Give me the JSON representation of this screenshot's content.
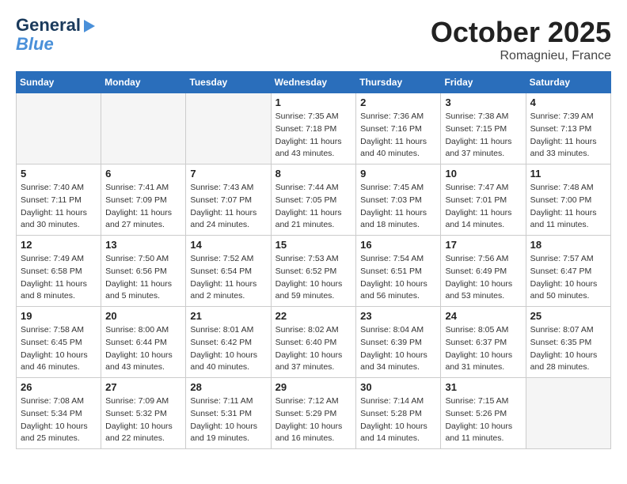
{
  "header": {
    "logo_line1": "General",
    "logo_line2": "Blue",
    "month": "October 2025",
    "location": "Romagnieu, France"
  },
  "weekdays": [
    "Sunday",
    "Monday",
    "Tuesday",
    "Wednesday",
    "Thursday",
    "Friday",
    "Saturday"
  ],
  "weeks": [
    [
      {
        "day": "",
        "info": ""
      },
      {
        "day": "",
        "info": ""
      },
      {
        "day": "",
        "info": ""
      },
      {
        "day": "1",
        "info": "Sunrise: 7:35 AM\nSunset: 7:18 PM\nDaylight: 11 hours\nand 43 minutes."
      },
      {
        "day": "2",
        "info": "Sunrise: 7:36 AM\nSunset: 7:16 PM\nDaylight: 11 hours\nand 40 minutes."
      },
      {
        "day": "3",
        "info": "Sunrise: 7:38 AM\nSunset: 7:15 PM\nDaylight: 11 hours\nand 37 minutes."
      },
      {
        "day": "4",
        "info": "Sunrise: 7:39 AM\nSunset: 7:13 PM\nDaylight: 11 hours\nand 33 minutes."
      }
    ],
    [
      {
        "day": "5",
        "info": "Sunrise: 7:40 AM\nSunset: 7:11 PM\nDaylight: 11 hours\nand 30 minutes."
      },
      {
        "day": "6",
        "info": "Sunrise: 7:41 AM\nSunset: 7:09 PM\nDaylight: 11 hours\nand 27 minutes."
      },
      {
        "day": "7",
        "info": "Sunrise: 7:43 AM\nSunset: 7:07 PM\nDaylight: 11 hours\nand 24 minutes."
      },
      {
        "day": "8",
        "info": "Sunrise: 7:44 AM\nSunset: 7:05 PM\nDaylight: 11 hours\nand 21 minutes."
      },
      {
        "day": "9",
        "info": "Sunrise: 7:45 AM\nSunset: 7:03 PM\nDaylight: 11 hours\nand 18 minutes."
      },
      {
        "day": "10",
        "info": "Sunrise: 7:47 AM\nSunset: 7:01 PM\nDaylight: 11 hours\nand 14 minutes."
      },
      {
        "day": "11",
        "info": "Sunrise: 7:48 AM\nSunset: 7:00 PM\nDaylight: 11 hours\nand 11 minutes."
      }
    ],
    [
      {
        "day": "12",
        "info": "Sunrise: 7:49 AM\nSunset: 6:58 PM\nDaylight: 11 hours\nand 8 minutes."
      },
      {
        "day": "13",
        "info": "Sunrise: 7:50 AM\nSunset: 6:56 PM\nDaylight: 11 hours\nand 5 minutes."
      },
      {
        "day": "14",
        "info": "Sunrise: 7:52 AM\nSunset: 6:54 PM\nDaylight: 11 hours\nand 2 minutes."
      },
      {
        "day": "15",
        "info": "Sunrise: 7:53 AM\nSunset: 6:52 PM\nDaylight: 10 hours\nand 59 minutes."
      },
      {
        "day": "16",
        "info": "Sunrise: 7:54 AM\nSunset: 6:51 PM\nDaylight: 10 hours\nand 56 minutes."
      },
      {
        "day": "17",
        "info": "Sunrise: 7:56 AM\nSunset: 6:49 PM\nDaylight: 10 hours\nand 53 minutes."
      },
      {
        "day": "18",
        "info": "Sunrise: 7:57 AM\nSunset: 6:47 PM\nDaylight: 10 hours\nand 50 minutes."
      }
    ],
    [
      {
        "day": "19",
        "info": "Sunrise: 7:58 AM\nSunset: 6:45 PM\nDaylight: 10 hours\nand 46 minutes."
      },
      {
        "day": "20",
        "info": "Sunrise: 8:00 AM\nSunset: 6:44 PM\nDaylight: 10 hours\nand 43 minutes."
      },
      {
        "day": "21",
        "info": "Sunrise: 8:01 AM\nSunset: 6:42 PM\nDaylight: 10 hours\nand 40 minutes."
      },
      {
        "day": "22",
        "info": "Sunrise: 8:02 AM\nSunset: 6:40 PM\nDaylight: 10 hours\nand 37 minutes."
      },
      {
        "day": "23",
        "info": "Sunrise: 8:04 AM\nSunset: 6:39 PM\nDaylight: 10 hours\nand 34 minutes."
      },
      {
        "day": "24",
        "info": "Sunrise: 8:05 AM\nSunset: 6:37 PM\nDaylight: 10 hours\nand 31 minutes."
      },
      {
        "day": "25",
        "info": "Sunrise: 8:07 AM\nSunset: 6:35 PM\nDaylight: 10 hours\nand 28 minutes."
      }
    ],
    [
      {
        "day": "26",
        "info": "Sunrise: 7:08 AM\nSunset: 5:34 PM\nDaylight: 10 hours\nand 25 minutes."
      },
      {
        "day": "27",
        "info": "Sunrise: 7:09 AM\nSunset: 5:32 PM\nDaylight: 10 hours\nand 22 minutes."
      },
      {
        "day": "28",
        "info": "Sunrise: 7:11 AM\nSunset: 5:31 PM\nDaylight: 10 hours\nand 19 minutes."
      },
      {
        "day": "29",
        "info": "Sunrise: 7:12 AM\nSunset: 5:29 PM\nDaylight: 10 hours\nand 16 minutes."
      },
      {
        "day": "30",
        "info": "Sunrise: 7:14 AM\nSunset: 5:28 PM\nDaylight: 10 hours\nand 14 minutes."
      },
      {
        "day": "31",
        "info": "Sunrise: 7:15 AM\nSunset: 5:26 PM\nDaylight: 10 hours\nand 11 minutes."
      },
      {
        "day": "",
        "info": ""
      }
    ]
  ]
}
